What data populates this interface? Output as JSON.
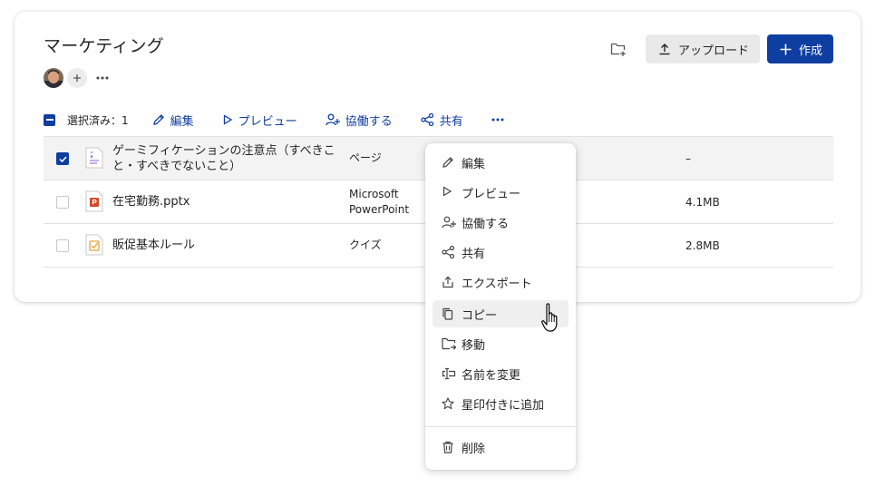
{
  "header": {
    "title": "マーケティング",
    "upload_label": "アップロード",
    "create_label": "作成"
  },
  "toolbar": {
    "selected_label": "選択済み：1",
    "edit_label": "編集",
    "preview_label": "プレビュー",
    "collaborate_label": "協働する",
    "share_label": "共有"
  },
  "files": [
    {
      "name": "ゲーミフィケーションの注意点（すべきこと・すべきでないこと）",
      "type": "ページ",
      "size": "–",
      "selected": true,
      "icon": "page-icon"
    },
    {
      "name": "在宅勤務.pptx",
      "type": "Microsoft PowerPoint",
      "size": "4.1MB",
      "selected": false,
      "icon": "powerpoint-icon"
    },
    {
      "name": "販促基本ルール",
      "type": "クイズ",
      "size": "2.8MB",
      "selected": false,
      "icon": "quiz-icon"
    }
  ],
  "menu": {
    "edit": "編集",
    "preview": "プレビュー",
    "collaborate": "協働する",
    "share": "共有",
    "export": "エクスポート",
    "copy": "コピー",
    "move": "移動",
    "rename": "名前を変更",
    "favorite": "星印付きに追加",
    "delete": "削除"
  },
  "colors": {
    "accent": "#0f3ea1",
    "selected_row": "#f3f3f3",
    "menu_hover": "#efefef"
  }
}
